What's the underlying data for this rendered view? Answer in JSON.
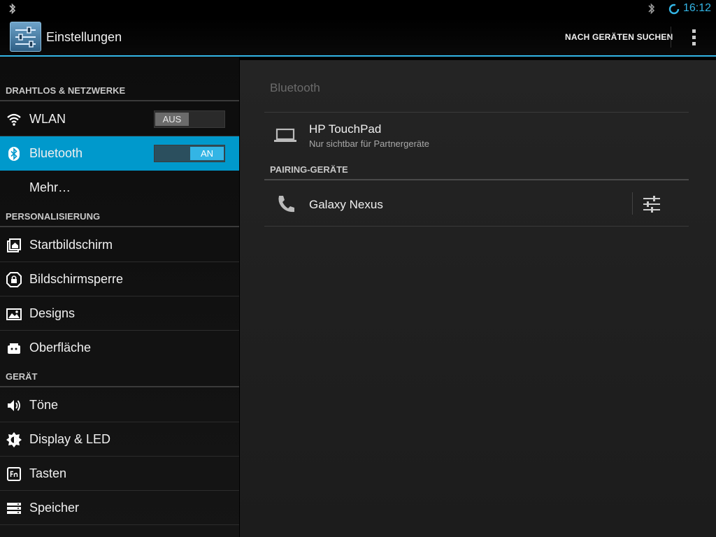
{
  "statusbar": {
    "time": "16:12",
    "accent": "#33b5e5",
    "icons": [
      "bluetooth-icon",
      "bluetooth-icon",
      "sync-icon"
    ]
  },
  "actionbar": {
    "title": "Einstellungen",
    "action_label": "NACH GERÄTEN SUCHEN",
    "icon": "settings-sliders-icon",
    "overflow_icon": "overflow-menu-icon"
  },
  "sidebar": {
    "sections": [
      {
        "header": "DRAHTLOS & NETZWERKE"
      },
      {
        "header": "PERSONALISIERUNG"
      },
      {
        "header": "GERÄT"
      }
    ],
    "items": [
      {
        "label": "WLAN",
        "icon": "wifi-icon",
        "toggle": "AUS",
        "toggle_on": false
      },
      {
        "label": "Bluetooth",
        "icon": "bluetooth-icon",
        "toggle": "AN",
        "toggle_on": true,
        "active": true
      },
      {
        "label": "Mehr…",
        "icon": ""
      },
      {
        "label": "Startbildschirm",
        "icon": "home-screen-icon"
      },
      {
        "label": "Bildschirmsperre",
        "icon": "lock-icon"
      },
      {
        "label": "Designs",
        "icon": "picture-icon"
      },
      {
        "label": "Oberfläche",
        "icon": "android-icon"
      },
      {
        "label": "Töne",
        "icon": "volume-icon"
      },
      {
        "label": "Display & LED",
        "icon": "brightness-icon"
      },
      {
        "label": "Tasten",
        "icon": "fn-key-icon"
      },
      {
        "label": "Speicher",
        "icon": "storage-icon"
      }
    ],
    "active_color": "#0099cc"
  },
  "detail": {
    "title": "Bluetooth",
    "this_device": {
      "name": "HP TouchPad",
      "subtitle": "Nur sichtbar für Partnergeräte",
      "icon": "laptop-icon"
    },
    "paired_header": "PAIRING-GERÄTE",
    "paired_devices": [
      {
        "name": "Galaxy Nexus",
        "icon": "phone-icon",
        "settings_icon": "settings-sliders-icon"
      }
    ]
  }
}
